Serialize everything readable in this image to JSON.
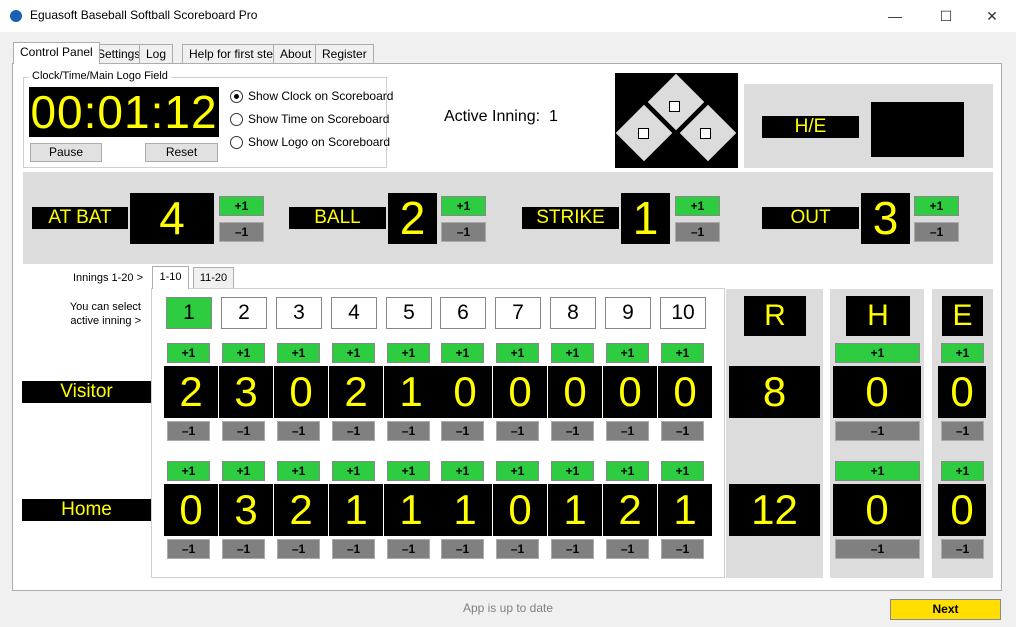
{
  "window": {
    "title": "Eguasoft Baseball Softball Scoreboard Pro",
    "minimize": "—",
    "maximize": "☐",
    "close": "✕"
  },
  "tabs": [
    "Control Panel",
    "Settings",
    "Log",
    "Help for first step",
    "About",
    "Register"
  ],
  "clock": {
    "group_label": "Clock/Time/Main Logo Field",
    "display": "00:01:12",
    "pause_label": "Pause",
    "reset_label": "Reset",
    "options": [
      {
        "label": "Show Clock on Scoreboard",
        "selected": true
      },
      {
        "label": "Show Time on Scoreboard",
        "selected": false
      },
      {
        "label": "Show Logo on Scoreboard",
        "selected": false
      }
    ]
  },
  "active_inning": {
    "label": "Active Inning:",
    "value": "1"
  },
  "he": {
    "label": "H/E",
    "value": ""
  },
  "count": [
    {
      "label": "AT BAT",
      "value": "4"
    },
    {
      "label": "BALL",
      "value": "2"
    },
    {
      "label": "STRIKE",
      "value": "1"
    },
    {
      "label": "OUT",
      "value": "3"
    }
  ],
  "buttons": {
    "plus": "+1",
    "minus": "–1"
  },
  "innings": {
    "range_label": "Innings 1-20 >",
    "select_hint_1": "You can select",
    "select_hint_2": "active inning >",
    "tabs": [
      "1-10",
      "11-20"
    ],
    "numbers": [
      "1",
      "2",
      "3",
      "4",
      "5",
      "6",
      "7",
      "8",
      "9",
      "10"
    ],
    "active_index": 0
  },
  "totals_headers": [
    "R",
    "H",
    "E"
  ],
  "teams": [
    {
      "name": "Visitor",
      "scores": [
        "2",
        "3",
        "0",
        "2",
        "1",
        "0",
        "0",
        "0",
        "0",
        "0"
      ],
      "R": "8",
      "H": "0",
      "E": "0"
    },
    {
      "name": "Home",
      "scores": [
        "0",
        "3",
        "2",
        "1",
        "1",
        "1",
        "0",
        "1",
        "2",
        "1"
      ],
      "R": "12",
      "H": "0",
      "E": "0"
    }
  ],
  "status": {
    "text": "App is up to date",
    "next_label": "Next"
  }
}
